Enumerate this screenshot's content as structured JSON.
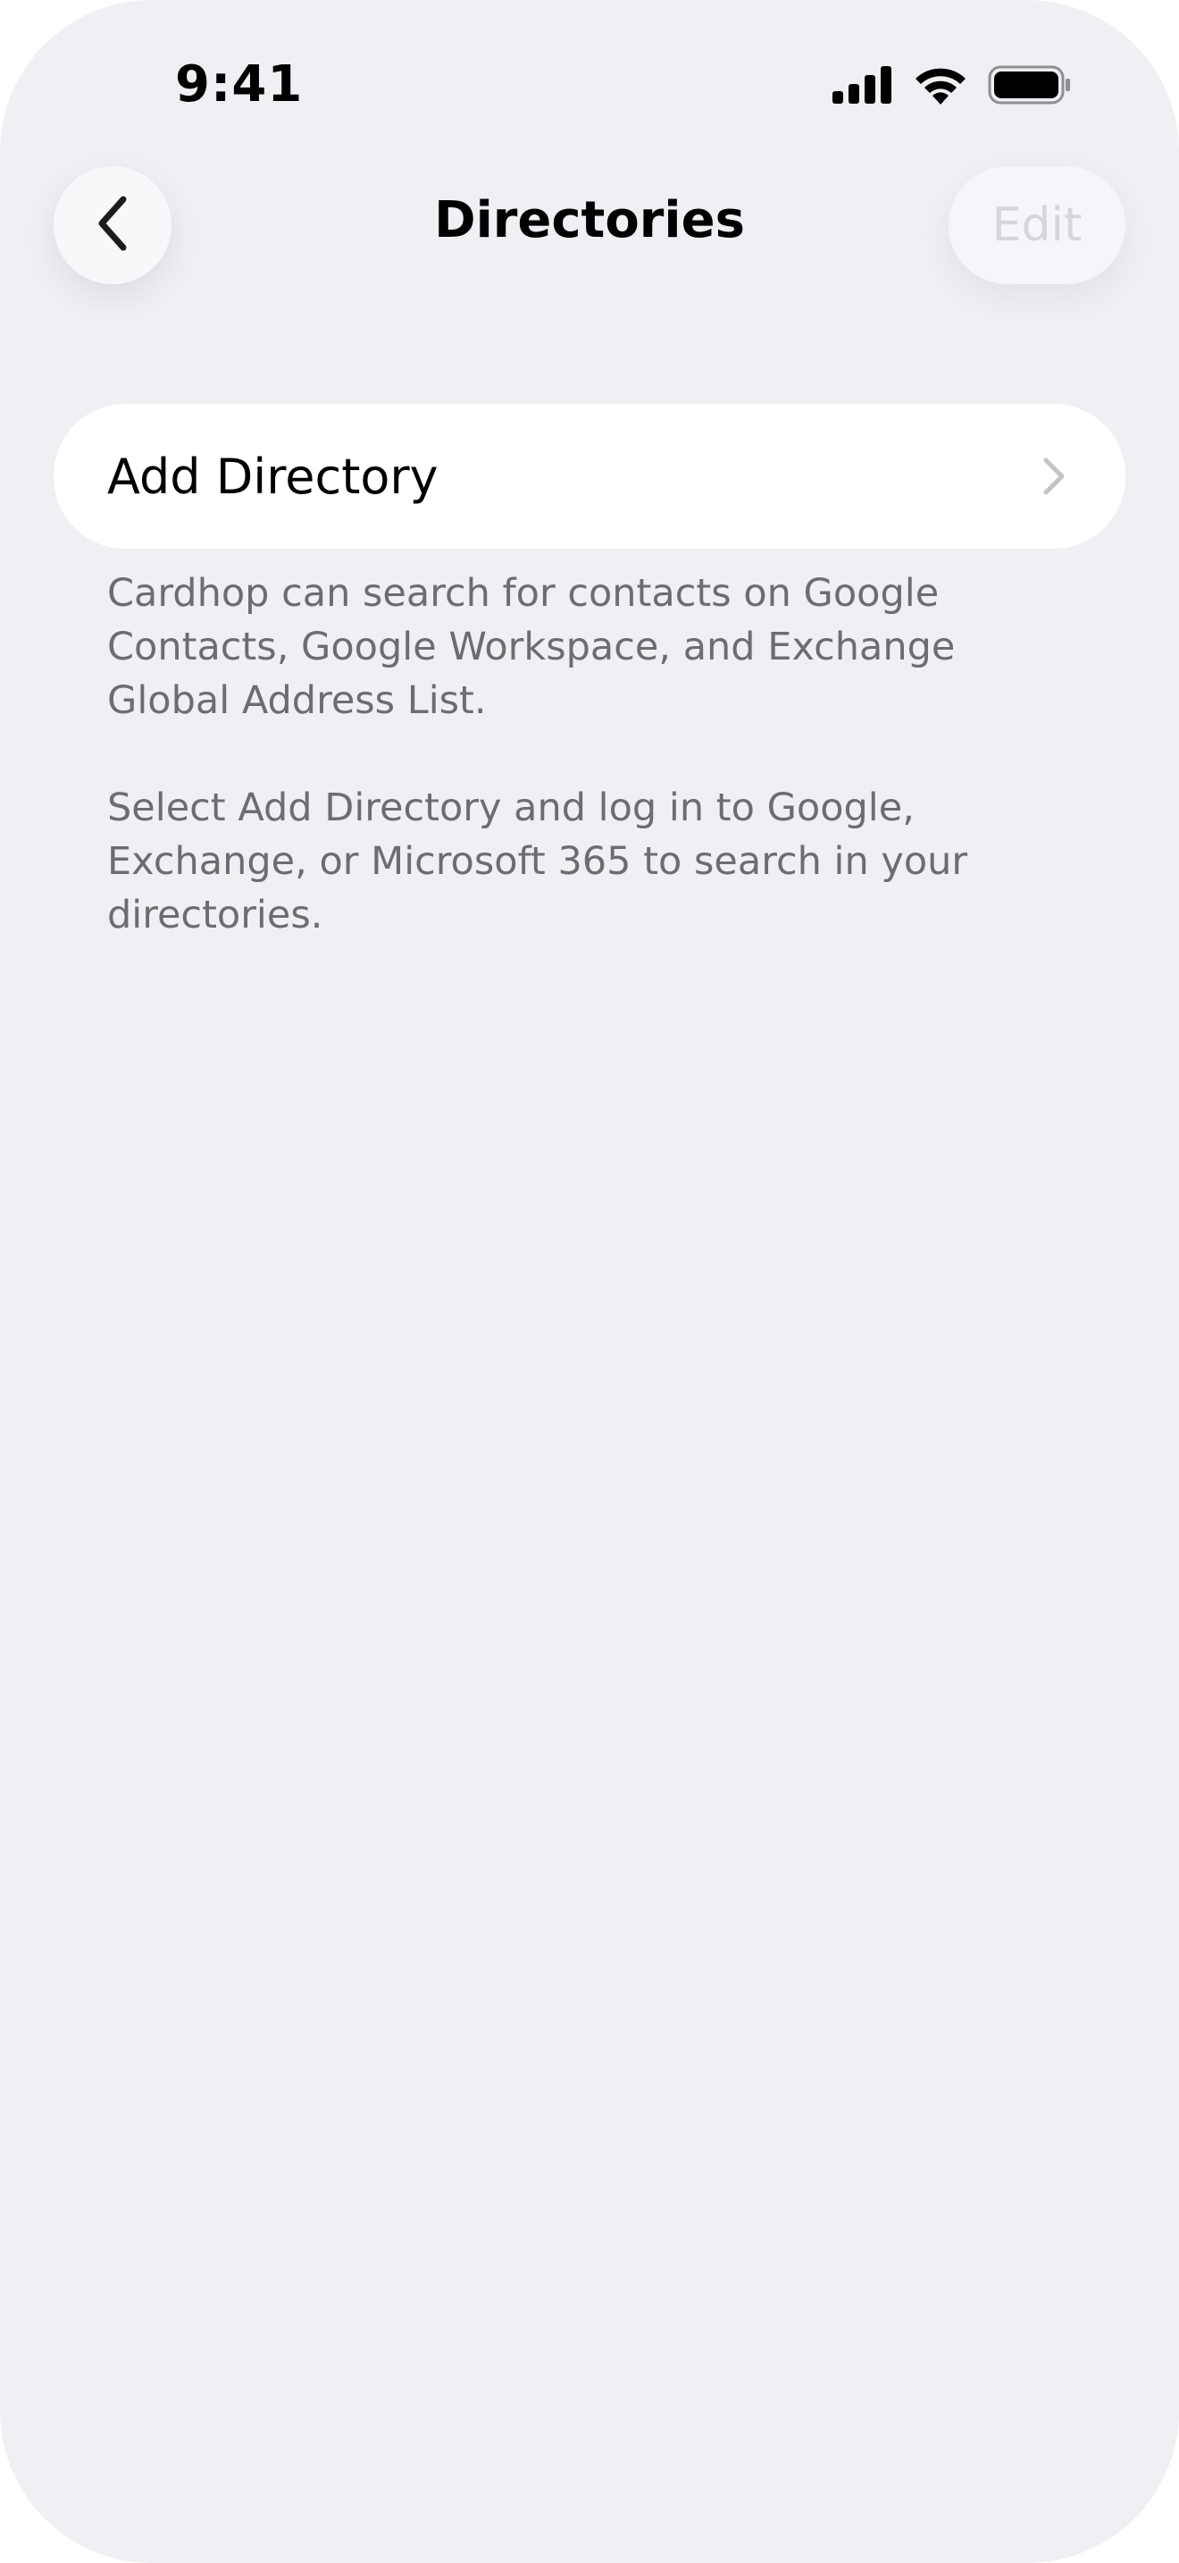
{
  "status_bar": {
    "time": "9:41",
    "icons": [
      "cellular-signal-icon",
      "wifi-icon",
      "battery-icon"
    ]
  },
  "nav": {
    "back_icon": "chevron-left-icon",
    "title": "Directories",
    "edit_label": "Edit"
  },
  "list": {
    "items": [
      {
        "label": "Add Directory",
        "icon": "chevron-right-icon"
      }
    ]
  },
  "footer": {
    "paragraph_1": "Cardhop can search for contacts on Google Contacts, Google Workspace, and Exchange Global Address List.",
    "paragraph_2": "Select Add Directory and log in to Google, Exchange, or Microsoft 365 to search in your directories."
  },
  "colors": {
    "background": "#f0eff4",
    "card": "#ffffff",
    "secondary_text": "#6c6c72",
    "disabled_text": "#d6d4dc",
    "chevron": "#c4c4c8"
  }
}
